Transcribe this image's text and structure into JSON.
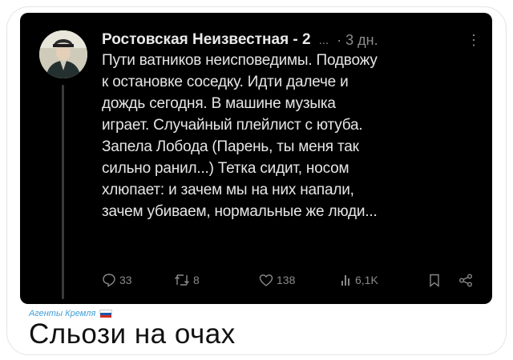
{
  "post": {
    "author": "Ростовская Неизвестная - 2",
    "handle_ellipsis": "...",
    "time": "· 3 дн.",
    "more": "⋮",
    "lines": [
      "Пути ватников неисповедимы. Подвожу",
      "к остановке соседку. Идти далече и",
      "дождь сегодня. В машине музыка",
      "играет. Случайный плейлист с ютуба.",
      "Запела Лобода (Парень, ты меня так",
      "сильно ранил...) Тетка сидит, носом",
      "хлюпает: и зачем мы на них напали,",
      "зачем убиваем, нормальные же люди..."
    ],
    "actions": {
      "replies": "33",
      "reposts": "8",
      "likes": "138",
      "views": "6,1K"
    }
  },
  "channel": {
    "name": "Агенты Кремля",
    "flag_colors": [
      "#ffffff",
      "#1c57a7",
      "#d52b1e"
    ]
  },
  "caption": "Сльози на очах",
  "colors": {
    "post_bg": "#000000",
    "text": "#e6e6e6",
    "muted": "#8a8a8a",
    "channel": "#3f9fd8"
  }
}
